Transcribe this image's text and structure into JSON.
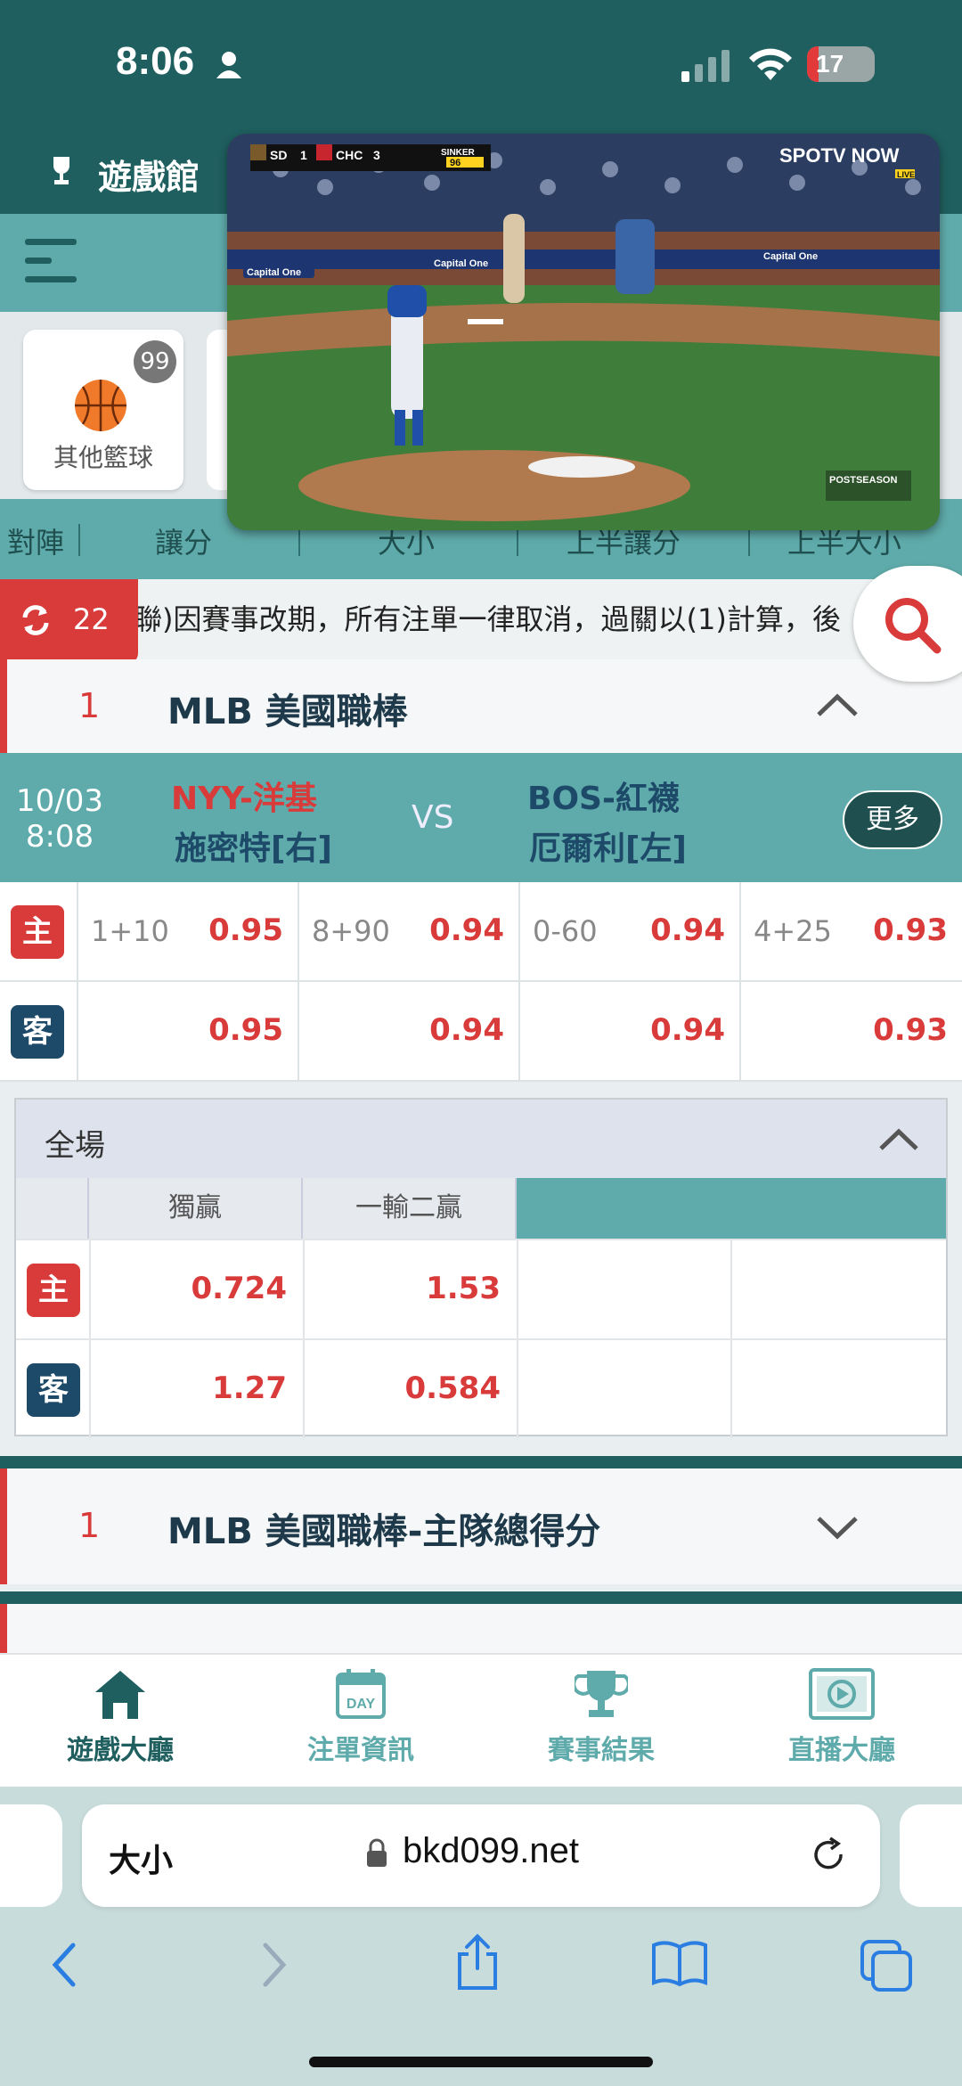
{
  "status_bar": {
    "time": "8:06",
    "battery": "17",
    "battery_level": 0.17,
    "battery_icon": "battery-charging-icon"
  },
  "header": {
    "title": "遊戲館"
  },
  "categories": [
    {
      "label": "其他籃球",
      "count": "99",
      "icon": "basketball-icon"
    }
  ],
  "tabs": [
    "對陣",
    "讓分",
    "大小",
    "上半讓分",
    "上半大小"
  ],
  "ticker": {
    "refresh_count": "22",
    "text": "聯)因賽事改期，所有注單一律取消，過關以(1)計算，後"
  },
  "league": {
    "index": "1",
    "name": "MLB 美國職棒"
  },
  "match": {
    "date": "10/03",
    "time": "8:08",
    "home_team": "NYY-洋基",
    "home_pitcher": "施密特[右]",
    "vs": "VS",
    "away_team": "BOS-紅襪",
    "away_pitcher": "厄爾利[左]",
    "more_label": "更多"
  },
  "odds": {
    "home_tag": "主",
    "away_tag": "客",
    "home": [
      {
        "line": "1+10",
        "value": "0.95"
      },
      {
        "line": "8+90",
        "value": "0.94"
      },
      {
        "line": "0-60",
        "value": "0.94"
      },
      {
        "line": "4+25",
        "value": "0.93"
      }
    ],
    "away": [
      {
        "line": "",
        "value": "0.95"
      },
      {
        "line": "",
        "value": "0.94"
      },
      {
        "line": "",
        "value": "0.94"
      },
      {
        "line": "",
        "value": "0.93"
      }
    ]
  },
  "full_game": {
    "title": "全場",
    "columns": [
      "獨贏",
      "一輸二贏"
    ],
    "home": [
      "0.724",
      "1.53"
    ],
    "away": [
      "1.27",
      "0.584"
    ]
  },
  "league_collapsed": {
    "index": "1",
    "name": "MLB 美國職棒-主隊總得分"
  },
  "bottom_nav": [
    {
      "label": "遊戲大廳",
      "icon": "home-icon",
      "active": true
    },
    {
      "label": "注單資訊",
      "icon": "calendar-day-icon",
      "active": false
    },
    {
      "label": "賽事結果",
      "icon": "trophy-icon",
      "active": false
    },
    {
      "label": "直播大廳",
      "icon": "play-screen-icon",
      "active": false
    }
  ],
  "browser": {
    "text_size": "大小",
    "url": "bkd099.net"
  },
  "video_overlay": {
    "scoreboard": {
      "away": "SD",
      "away_score": "1",
      "home": "CHC",
      "home_score": "3",
      "pitch": "SINKER",
      "speed": "96"
    },
    "brand": "SPOTV NOW",
    "live": "LIVE",
    "ad": "Capital One",
    "series": "POSTSEASON"
  },
  "colors": {
    "teal_dark": "#1f5f5f",
    "teal": "#5faaaa",
    "red": "#d93a3a",
    "navy": "#1e4a6a"
  }
}
